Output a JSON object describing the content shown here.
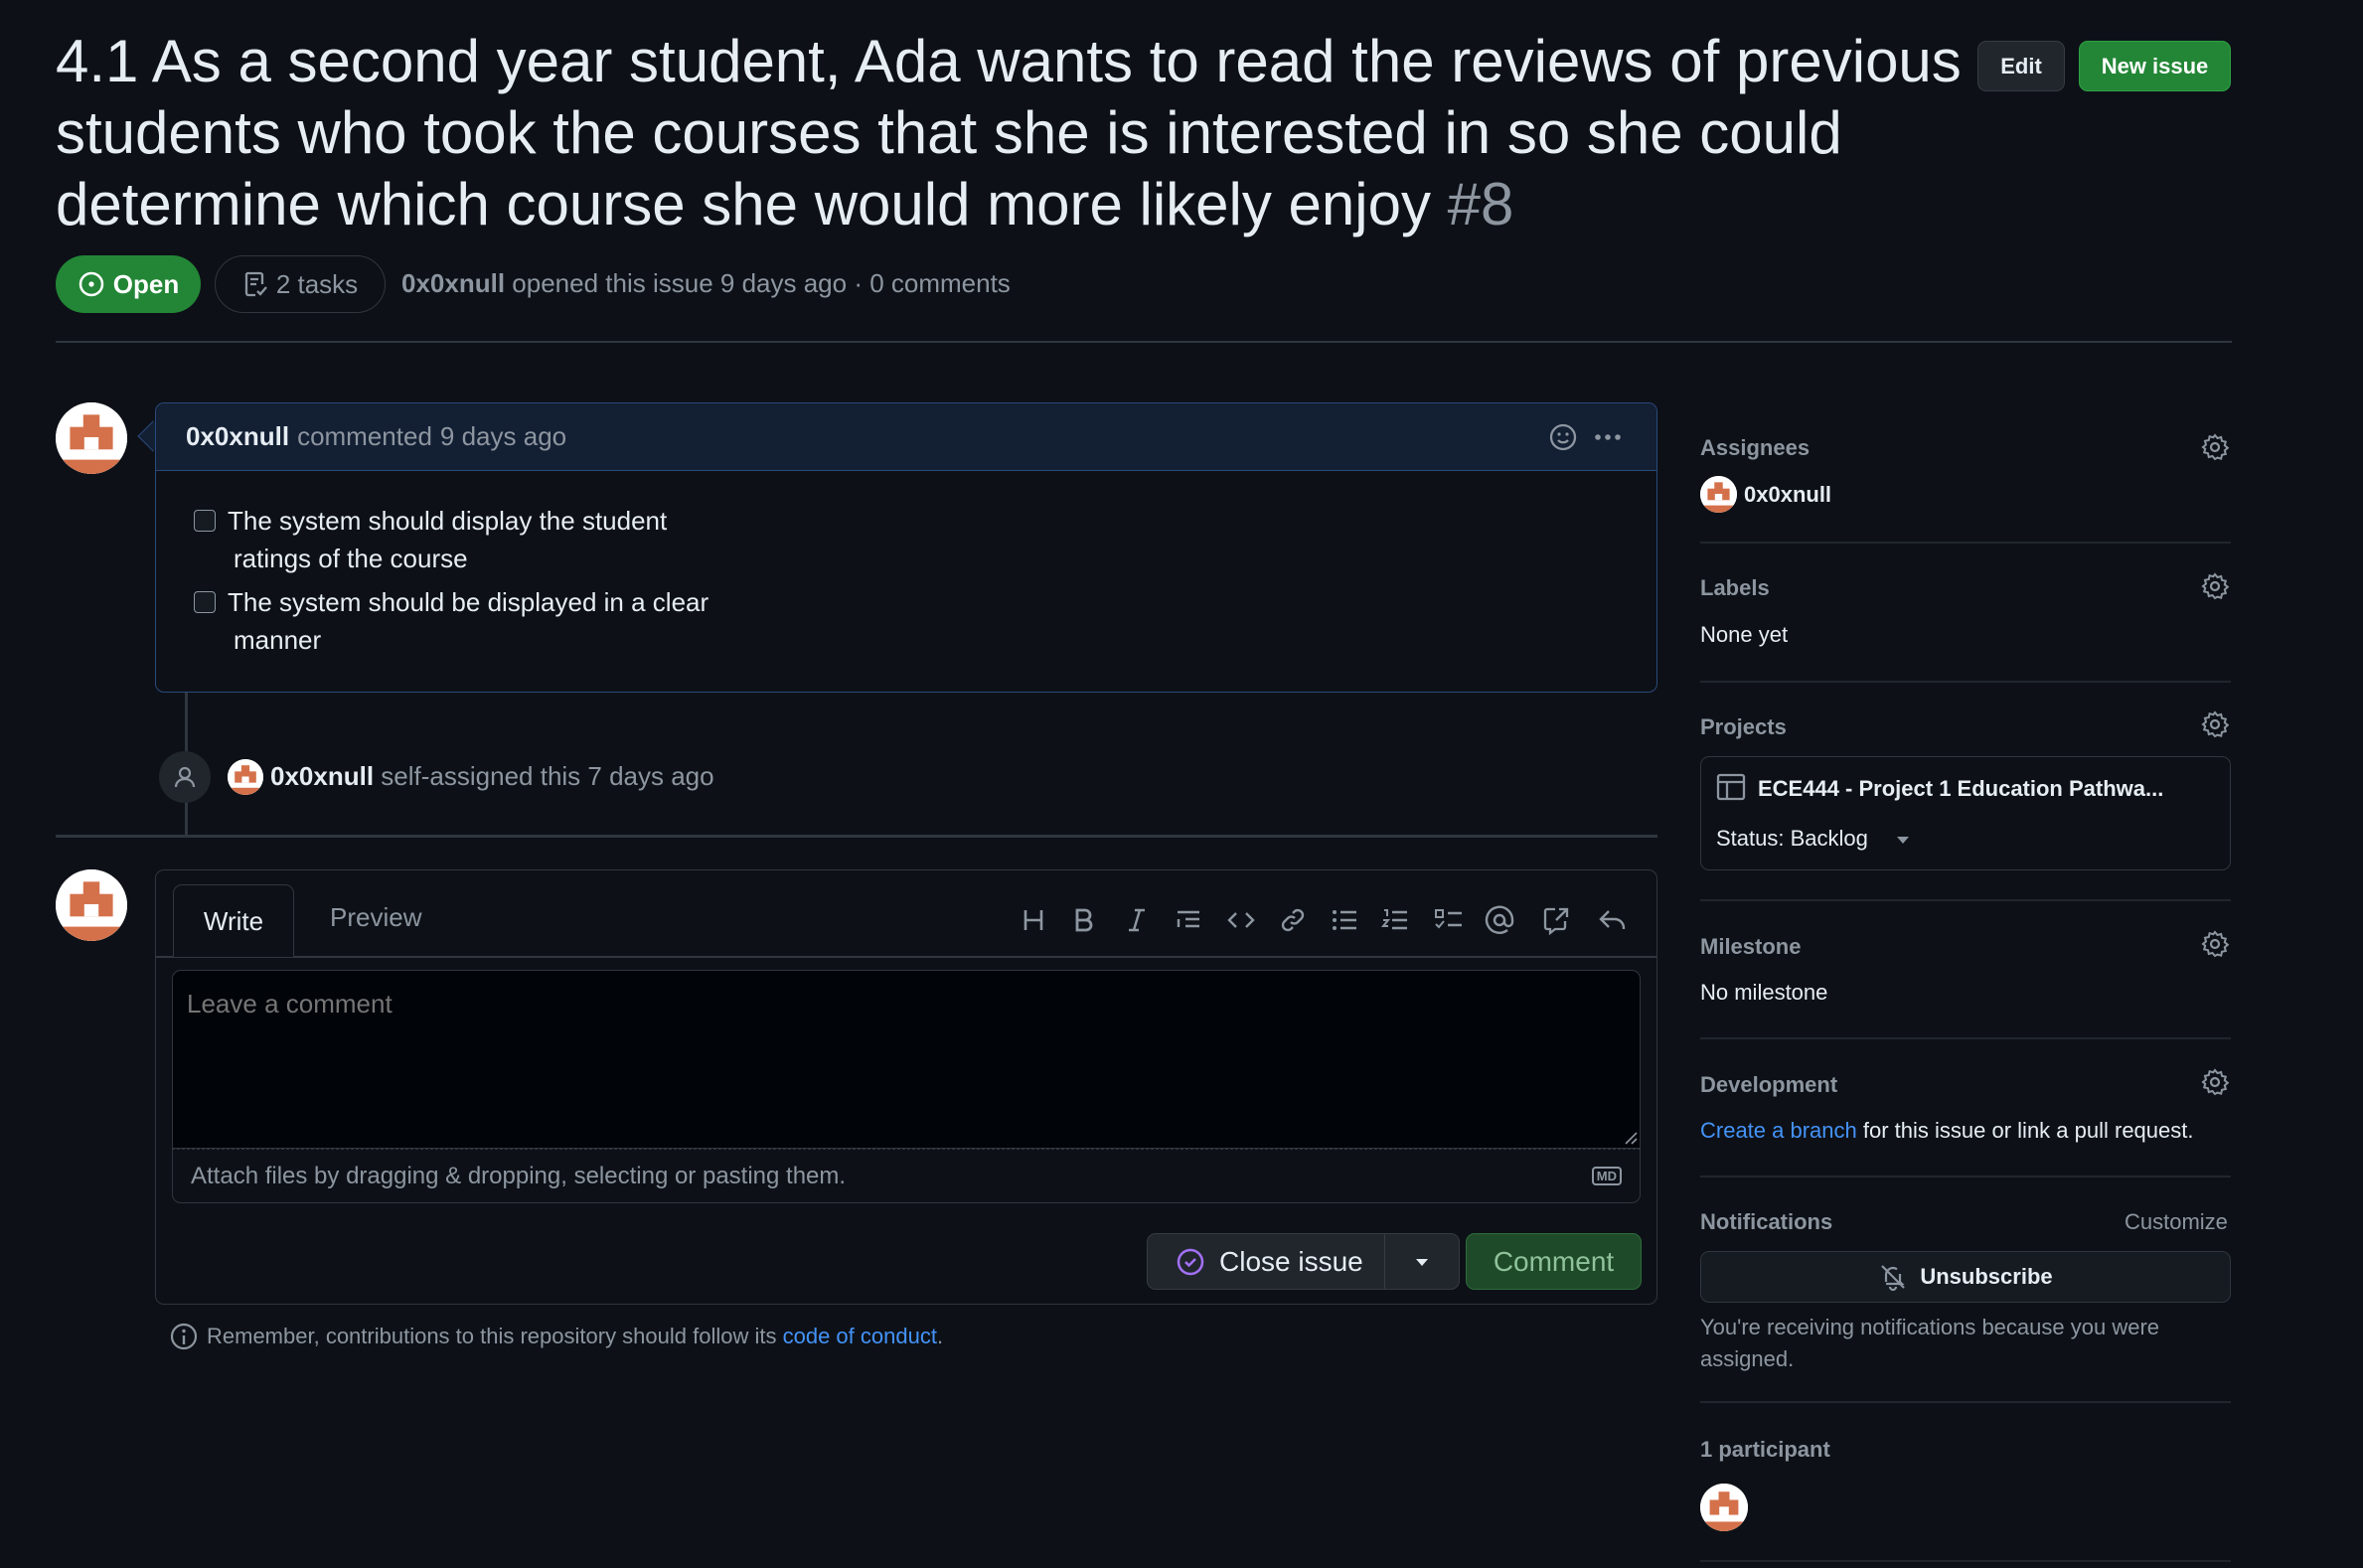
{
  "header": {
    "title": "4.1 As a second year student, Ada wants to read the reviews of previous students who took the courses that she is interested in so she could determine which course she would more likely enjoy",
    "issue_number": "#8",
    "edit_label": "Edit",
    "new_issue_label": "New issue",
    "state": "Open",
    "tasks": "2 tasks",
    "author": "0x0xnull",
    "meta_text": "opened this issue 9 days ago · 0 comments"
  },
  "comment": {
    "author": "0x0xnull",
    "action": "commented",
    "time": "9 days ago",
    "tasks": [
      {
        "line1": "The system should display the student",
        "line2": "ratings of the course",
        "checked": false
      },
      {
        "line1": "The system should be displayed in a clear",
        "line2": "manner",
        "checked": false
      }
    ]
  },
  "event": {
    "actor": "0x0xnull",
    "text": "self-assigned this 7 days ago"
  },
  "editor": {
    "tab_write": "Write",
    "tab_preview": "Preview",
    "placeholder": "Leave a comment",
    "attach_text": "Attach files by dragging & dropping, selecting or pasting them.",
    "md_badge": "MD",
    "close_issue_label": "Close issue",
    "comment_label": "Comment",
    "remember_text": "Remember, contributions to this repository should follow its",
    "conduct_link": "code of conduct",
    "period": "."
  },
  "sidebar": {
    "assignees_label": "Assignees",
    "assignee": "0x0xnull",
    "labels_label": "Labels",
    "labels_value": "None yet",
    "projects_label": "Projects",
    "project_name": "ECE444 - Project 1 Education Pathwa...",
    "project_status": "Status: Backlog",
    "milestone_label": "Milestone",
    "milestone_value": "No milestone",
    "development_label": "Development",
    "dev_link": "Create a branch",
    "dev_text": "for this issue or link a pull request.",
    "notifications_label": "Notifications",
    "customize_label": "Customize",
    "unsubscribe_label": "Unsubscribe",
    "notif_reason_line1": "You're receiving notifications because you were",
    "notif_reason_line2": "assigned.",
    "participants_label": "1 participant"
  },
  "colors": {
    "background": "#0d1117",
    "open_green": "#238636",
    "link_blue": "#4493f8",
    "comment_border": "#2a4a7b",
    "avatar_orange": "#d4714a"
  }
}
